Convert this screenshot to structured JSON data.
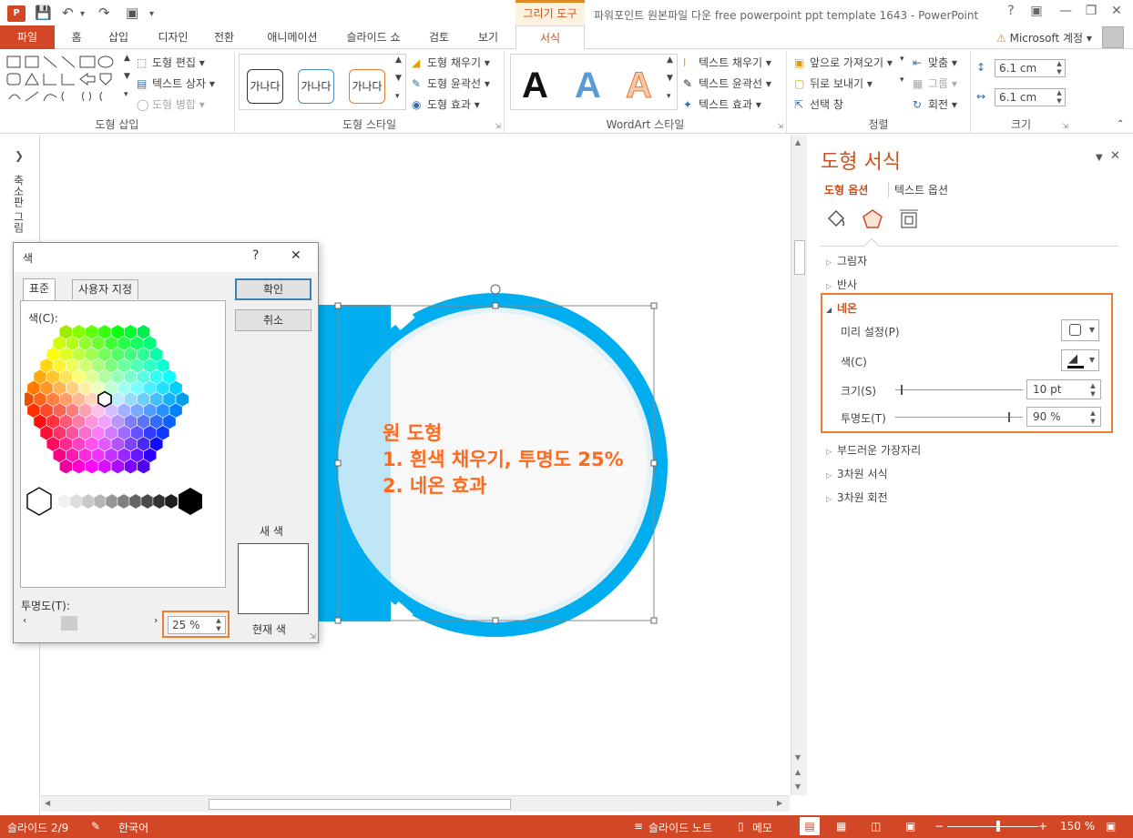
{
  "app": {
    "logo": "P",
    "document_title": "파워포인트 원본파일 다운 free powerpoint ppt template 1643 - PowerPoint",
    "context_tab_group": "그리기 도구",
    "account": "Microsoft 계정"
  },
  "tabs": [
    "파일",
    "홈",
    "삽입",
    "디자인",
    "전환",
    "애니메이션",
    "슬라이드 쇼",
    "검토",
    "보기",
    "서식"
  ],
  "ribbon": {
    "insert_shapes": {
      "label": "도형 삽입",
      "edit_shape": "도형 편집",
      "text_box": "텍스트 상자",
      "merge_shapes": "도형 병합"
    },
    "shape_styles": {
      "label": "도형 스타일",
      "preset_text": "가나다",
      "fill": "도형 채우기",
      "outline": "도형 윤곽선",
      "effects": "도형 효과"
    },
    "wordart": {
      "label": "WordArt 스타일",
      "letter": "A",
      "text_fill": "텍스트 채우기",
      "text_outline": "텍스트 윤곽선",
      "text_effects": "텍스트 효과"
    },
    "arrange": {
      "label": "정렬",
      "bring_forward": "앞으로 가져오기",
      "send_backward": "뒤로 보내기",
      "selection_pane": "선택 창",
      "align": "맞춤",
      "group": "그룹",
      "rotate": "회전"
    },
    "size": {
      "label": "크기",
      "height": "6.1 cm",
      "width": "6.1 cm"
    }
  },
  "left_pane": {
    "label": "축소판 그림"
  },
  "slide": {
    "annotation_line1": "원 도형",
    "annotation_line2": "1. 흰색 채우기, 투명도 25%",
    "annotation_line3": "2. 네온 효과"
  },
  "format_pane": {
    "title": "도형 서식",
    "tab_shape": "도형 옵션",
    "tab_text": "텍스트 옵션",
    "sections": {
      "shadow": "그림자",
      "reflection": "반사",
      "glow": "네온",
      "soft_edges": "부드러운 가장자리",
      "format_3d": "3차원 서식",
      "rotation_3d": "3차원 회전"
    },
    "glow": {
      "presets_label": "미리 설정(P)",
      "color_label": "색(C)",
      "size_label": "크기(S)",
      "size_value": "10 pt",
      "transparency_label": "투명도(T)",
      "transparency_value": "90 %",
      "size_fraction": 0.04,
      "transparency_fraction": 0.9
    }
  },
  "color_dialog": {
    "title": "색",
    "help": "?",
    "tab_standard": "표준",
    "tab_custom": "사용자 지정",
    "colors_label": "색(C):",
    "ok": "확인",
    "cancel": "취소",
    "new_label": "새 색",
    "current_label": "현재 색",
    "transparency_label": "투명도(T):",
    "transparency_value": "25 %",
    "transparency_fraction": 0.25
  },
  "status": {
    "slide": "슬라이드 2/9",
    "language": "한국어",
    "notes": "슬라이드 노트",
    "comments": "메모",
    "zoom": "150 %"
  },
  "colors": {
    "accent": "#d24726",
    "highlight": "#ed7d31",
    "slide_blue": "#00aeef",
    "circle_fill": "#f7f7f7"
  }
}
